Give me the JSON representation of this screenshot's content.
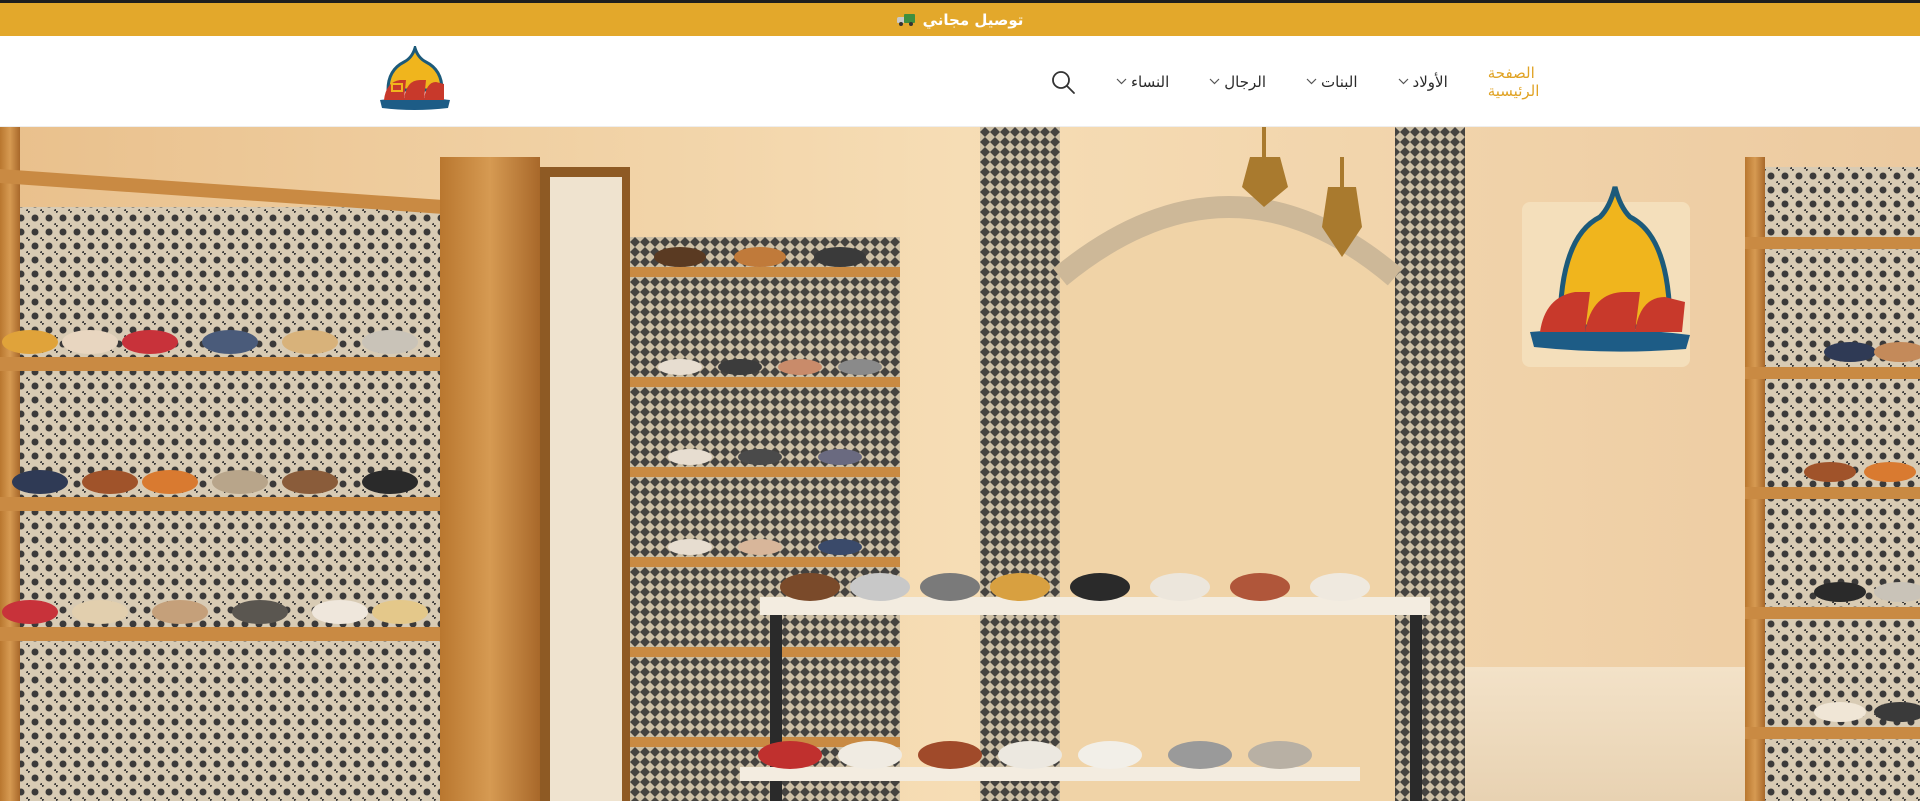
{
  "announcement": {
    "text": "توصيل مجاني",
    "icon": "truck-icon"
  },
  "header": {
    "logo": "sandal-logo",
    "nav": [
      {
        "label": "النساء",
        "has_dropdown": true
      },
      {
        "label": "الرجال",
        "has_dropdown": true
      },
      {
        "label": "البنات",
        "has_dropdown": true
      },
      {
        "label": "الأولاد",
        "has_dropdown": true
      },
      {
        "label": "الصفحة الرئيسية",
        "has_dropdown": false,
        "active": true
      }
    ],
    "search_icon": "search-icon"
  },
  "hero": {
    "image": "shoe-store-interior"
  },
  "colors": {
    "accent": "#e3a82b",
    "active_link": "#e0a325",
    "header_bg": "#ffffff"
  }
}
